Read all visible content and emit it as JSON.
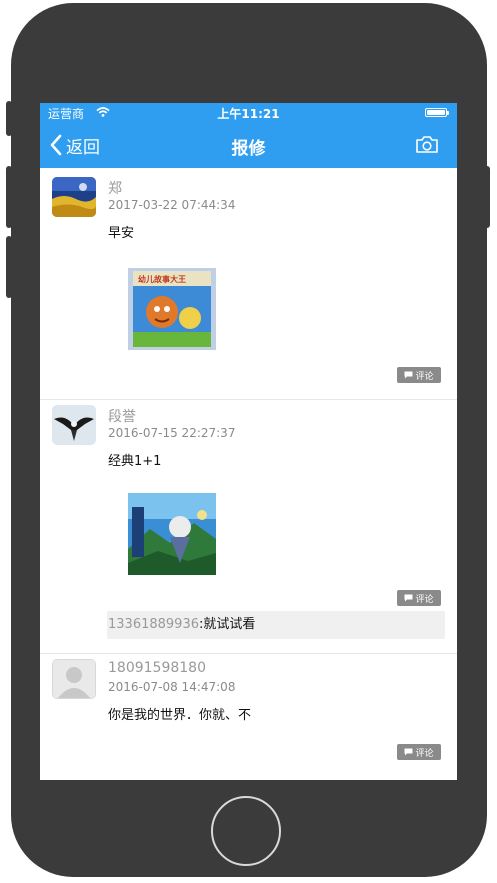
{
  "status_bar": {
    "carrier": "运营商",
    "time": "上午11:21"
  },
  "nav": {
    "back_label": "返回",
    "title": "报修"
  },
  "posts": [
    {
      "name": "郑",
      "time": "2017-03-22 07:44:34",
      "text": "早安",
      "image_caption": "幼儿故事大王",
      "comment_label": "评论"
    },
    {
      "name": "段誉",
      "time": "2016-07-15 22:27:37",
      "text": "经典1+1",
      "comment_label": "评论",
      "comments": [
        {
          "user": "13361889936",
          "text": ":就试试看"
        }
      ]
    },
    {
      "name": "18091598180",
      "time": "2016-07-08 14:47:08",
      "text": "你是我的世界．你就、不",
      "comment_label": "评论"
    }
  ],
  "colors": {
    "accent": "#2f9ef0",
    "device": "#3b3b3b",
    "comment_button": "#8a8a8a",
    "divider": "#e6e6e6"
  },
  "icons": [
    "wifi-icon",
    "battery-icon",
    "back-chevron-icon",
    "camera-icon",
    "comment-icon",
    "default-avatar-icon"
  ]
}
